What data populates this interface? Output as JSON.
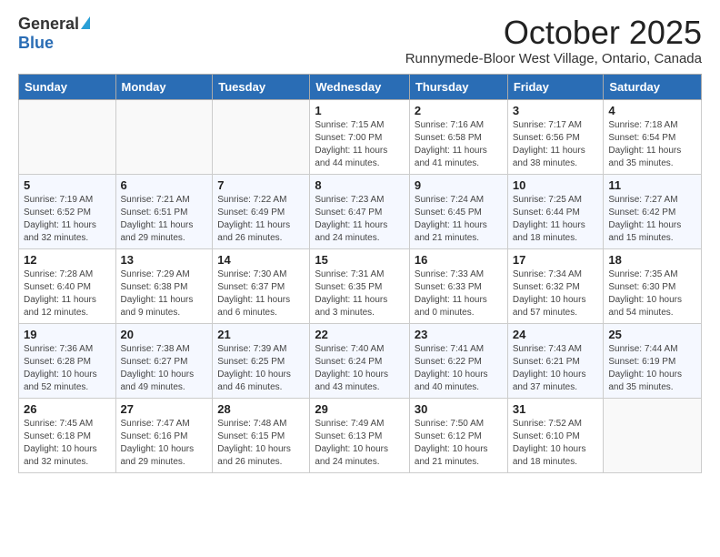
{
  "logo": {
    "general": "General",
    "blue": "Blue"
  },
  "header": {
    "month": "October 2025",
    "location": "Runnymede-Bloor West Village, Ontario, Canada"
  },
  "days_of_week": [
    "Sunday",
    "Monday",
    "Tuesday",
    "Wednesday",
    "Thursday",
    "Friday",
    "Saturday"
  ],
  "weeks": [
    [
      {
        "day": "",
        "info": ""
      },
      {
        "day": "",
        "info": ""
      },
      {
        "day": "",
        "info": ""
      },
      {
        "day": "1",
        "info": "Sunrise: 7:15 AM\nSunset: 7:00 PM\nDaylight: 11 hours and 44 minutes."
      },
      {
        "day": "2",
        "info": "Sunrise: 7:16 AM\nSunset: 6:58 PM\nDaylight: 11 hours and 41 minutes."
      },
      {
        "day": "3",
        "info": "Sunrise: 7:17 AM\nSunset: 6:56 PM\nDaylight: 11 hours and 38 minutes."
      },
      {
        "day": "4",
        "info": "Sunrise: 7:18 AM\nSunset: 6:54 PM\nDaylight: 11 hours and 35 minutes."
      }
    ],
    [
      {
        "day": "5",
        "info": "Sunrise: 7:19 AM\nSunset: 6:52 PM\nDaylight: 11 hours and 32 minutes."
      },
      {
        "day": "6",
        "info": "Sunrise: 7:21 AM\nSunset: 6:51 PM\nDaylight: 11 hours and 29 minutes."
      },
      {
        "day": "7",
        "info": "Sunrise: 7:22 AM\nSunset: 6:49 PM\nDaylight: 11 hours and 26 minutes."
      },
      {
        "day": "8",
        "info": "Sunrise: 7:23 AM\nSunset: 6:47 PM\nDaylight: 11 hours and 24 minutes."
      },
      {
        "day": "9",
        "info": "Sunrise: 7:24 AM\nSunset: 6:45 PM\nDaylight: 11 hours and 21 minutes."
      },
      {
        "day": "10",
        "info": "Sunrise: 7:25 AM\nSunset: 6:44 PM\nDaylight: 11 hours and 18 minutes."
      },
      {
        "day": "11",
        "info": "Sunrise: 7:27 AM\nSunset: 6:42 PM\nDaylight: 11 hours and 15 minutes."
      }
    ],
    [
      {
        "day": "12",
        "info": "Sunrise: 7:28 AM\nSunset: 6:40 PM\nDaylight: 11 hours and 12 minutes."
      },
      {
        "day": "13",
        "info": "Sunrise: 7:29 AM\nSunset: 6:38 PM\nDaylight: 11 hours and 9 minutes."
      },
      {
        "day": "14",
        "info": "Sunrise: 7:30 AM\nSunset: 6:37 PM\nDaylight: 11 hours and 6 minutes."
      },
      {
        "day": "15",
        "info": "Sunrise: 7:31 AM\nSunset: 6:35 PM\nDaylight: 11 hours and 3 minutes."
      },
      {
        "day": "16",
        "info": "Sunrise: 7:33 AM\nSunset: 6:33 PM\nDaylight: 11 hours and 0 minutes."
      },
      {
        "day": "17",
        "info": "Sunrise: 7:34 AM\nSunset: 6:32 PM\nDaylight: 10 hours and 57 minutes."
      },
      {
        "day": "18",
        "info": "Sunrise: 7:35 AM\nSunset: 6:30 PM\nDaylight: 10 hours and 54 minutes."
      }
    ],
    [
      {
        "day": "19",
        "info": "Sunrise: 7:36 AM\nSunset: 6:28 PM\nDaylight: 10 hours and 52 minutes."
      },
      {
        "day": "20",
        "info": "Sunrise: 7:38 AM\nSunset: 6:27 PM\nDaylight: 10 hours and 49 minutes."
      },
      {
        "day": "21",
        "info": "Sunrise: 7:39 AM\nSunset: 6:25 PM\nDaylight: 10 hours and 46 minutes."
      },
      {
        "day": "22",
        "info": "Sunrise: 7:40 AM\nSunset: 6:24 PM\nDaylight: 10 hours and 43 minutes."
      },
      {
        "day": "23",
        "info": "Sunrise: 7:41 AM\nSunset: 6:22 PM\nDaylight: 10 hours and 40 minutes."
      },
      {
        "day": "24",
        "info": "Sunrise: 7:43 AM\nSunset: 6:21 PM\nDaylight: 10 hours and 37 minutes."
      },
      {
        "day": "25",
        "info": "Sunrise: 7:44 AM\nSunset: 6:19 PM\nDaylight: 10 hours and 35 minutes."
      }
    ],
    [
      {
        "day": "26",
        "info": "Sunrise: 7:45 AM\nSunset: 6:18 PM\nDaylight: 10 hours and 32 minutes."
      },
      {
        "day": "27",
        "info": "Sunrise: 7:47 AM\nSunset: 6:16 PM\nDaylight: 10 hours and 29 minutes."
      },
      {
        "day": "28",
        "info": "Sunrise: 7:48 AM\nSunset: 6:15 PM\nDaylight: 10 hours and 26 minutes."
      },
      {
        "day": "29",
        "info": "Sunrise: 7:49 AM\nSunset: 6:13 PM\nDaylight: 10 hours and 24 minutes."
      },
      {
        "day": "30",
        "info": "Sunrise: 7:50 AM\nSunset: 6:12 PM\nDaylight: 10 hours and 21 minutes."
      },
      {
        "day": "31",
        "info": "Sunrise: 7:52 AM\nSunset: 6:10 PM\nDaylight: 10 hours and 18 minutes."
      },
      {
        "day": "",
        "info": ""
      }
    ]
  ]
}
